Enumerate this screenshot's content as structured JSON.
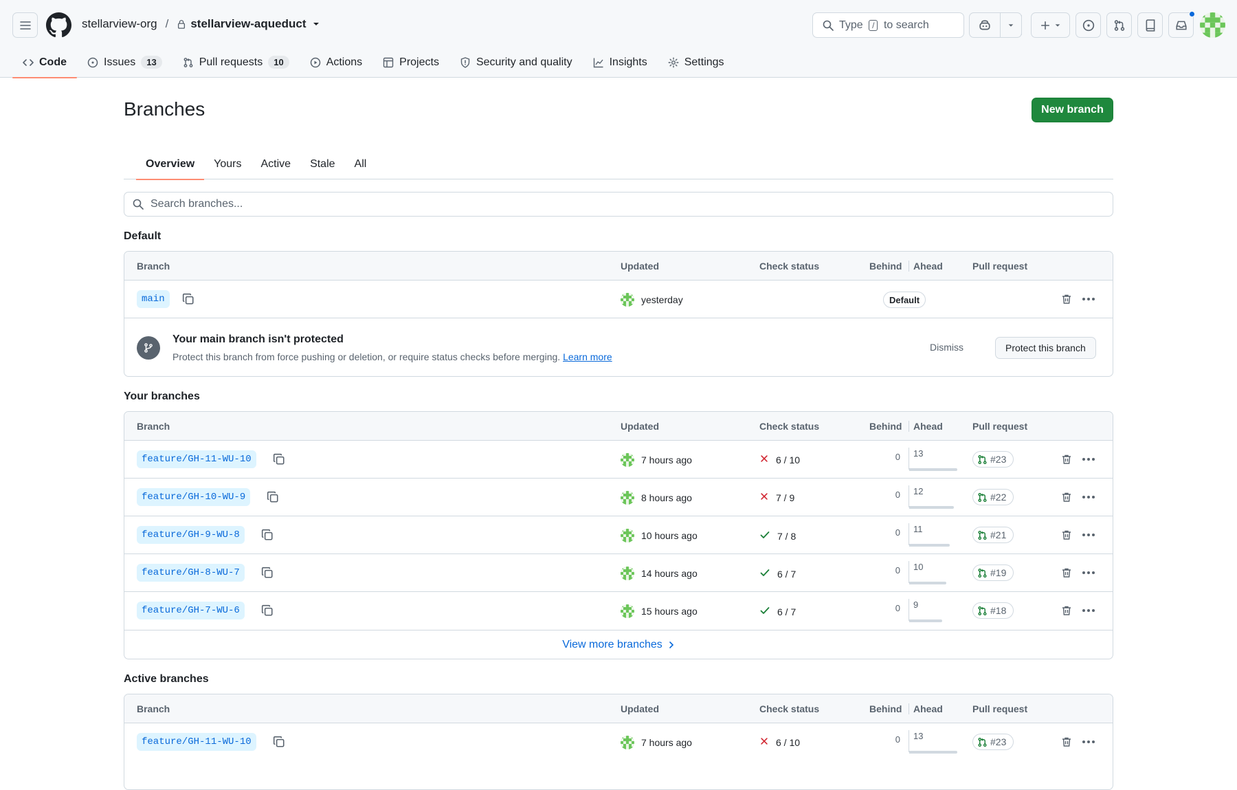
{
  "header": {
    "owner": "stellarview-org",
    "separator": "/",
    "repo": "stellarview-aqueduct",
    "search_prefix": "Type",
    "search_key": "/",
    "search_suffix": "to search"
  },
  "nav": {
    "code": "Code",
    "issues": "Issues",
    "issues_count": "13",
    "pulls": "Pull requests",
    "pulls_count": "10",
    "actions": "Actions",
    "projects": "Projects",
    "security": "Security and quality",
    "insights": "Insights",
    "settings": "Settings"
  },
  "page": {
    "title": "Branches",
    "new_branch": "New branch",
    "tabs": [
      "Overview",
      "Yours",
      "Active",
      "Stale",
      "All"
    ],
    "search_placeholder": "Search branches..."
  },
  "columns": {
    "branch": "Branch",
    "updated": "Updated",
    "check": "Check status",
    "behind": "Behind",
    "ahead": "Ahead",
    "pr": "Pull request"
  },
  "default_section": {
    "label": "Default",
    "branch": "main",
    "updated": "yesterday",
    "badge": "Default",
    "protect_title": "Your main branch isn't protected",
    "protect_desc": "Protect this branch from force pushing or deletion, or require status checks before merging.",
    "learn_more": "Learn more",
    "dismiss": "Dismiss",
    "protect_button": "Protect this branch"
  },
  "your_section": {
    "label": "Your branches",
    "rows": [
      {
        "branch": "feature/GH-11-WU-10",
        "updated": "7 hours ago",
        "status": "fail",
        "check": "6 / 10",
        "behind": "0",
        "ahead": "13",
        "pr": "#23"
      },
      {
        "branch": "feature/GH-10-WU-9",
        "updated": "8 hours ago",
        "status": "fail",
        "check": "7 / 9",
        "behind": "0",
        "ahead": "12",
        "pr": "#22"
      },
      {
        "branch": "feature/GH-9-WU-8",
        "updated": "10 hours ago",
        "status": "pass",
        "check": "7 / 8",
        "behind": "0",
        "ahead": "11",
        "pr": "#21"
      },
      {
        "branch": "feature/GH-8-WU-7",
        "updated": "14 hours ago",
        "status": "pass",
        "check": "6 / 7",
        "behind": "0",
        "ahead": "10",
        "pr": "#19"
      },
      {
        "branch": "feature/GH-7-WU-6",
        "updated": "15 hours ago",
        "status": "pass",
        "check": "6 / 7",
        "behind": "0",
        "ahead": "9",
        "pr": "#18"
      }
    ],
    "view_more": "View more branches"
  },
  "active_section": {
    "label": "Active branches",
    "rows": [
      {
        "branch": "feature/GH-11-WU-10",
        "updated": "7 hours ago",
        "status": "fail",
        "check": "6 / 10",
        "behind": "0",
        "ahead": "13",
        "pr": "#23"
      }
    ]
  },
  "colors": {
    "accent": "#0969da",
    "primary_button": "#1f883d",
    "fail": "#d1242f",
    "pass": "#1a7f37",
    "tab_underline": "#fd8c73"
  }
}
